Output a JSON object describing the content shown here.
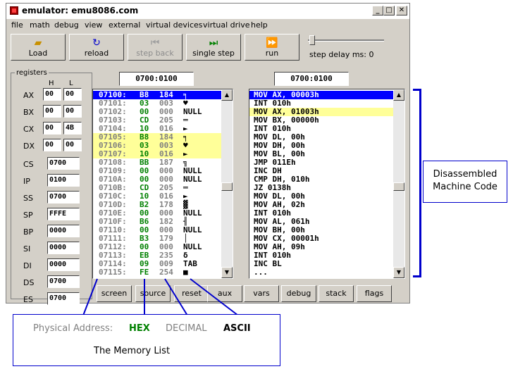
{
  "window": {
    "title": "emulator: emu8086.com",
    "min_glyph": "_",
    "max_glyph": "□",
    "close_glyph": "✕"
  },
  "menu": [
    "file",
    "math",
    "debug",
    "view",
    "external",
    "virtual devices",
    "virtual drive",
    "help"
  ],
  "toolbar": {
    "load": "Load",
    "reload": "reload",
    "step_back": "step back",
    "single_step": "single step",
    "run": "run",
    "step_delay_label": "step delay ms: 0"
  },
  "registers": {
    "title": "registers",
    "h_label": "H",
    "l_label": "L",
    "general": [
      {
        "name": "AX",
        "h": "00",
        "l": "00"
      },
      {
        "name": "BX",
        "h": "00",
        "l": "00"
      },
      {
        "name": "CX",
        "h": "00",
        "l": "4B"
      },
      {
        "name": "DX",
        "h": "00",
        "l": "00"
      }
    ],
    "segment": [
      {
        "name": "CS",
        "value": "0700"
      },
      {
        "name": "IP",
        "value": "0100"
      },
      {
        "name": "SS",
        "value": "0700"
      },
      {
        "name": "SP",
        "value": "FFFE"
      },
      {
        "name": "BP",
        "value": "0000"
      },
      {
        "name": "SI",
        "value": "0000"
      },
      {
        "name": "DI",
        "value": "0000"
      },
      {
        "name": "DS",
        "value": "0700"
      },
      {
        "name": "ES",
        "value": "0700"
      }
    ]
  },
  "memory_address": "0700:0100",
  "disasm_address": "0700:0100",
  "memory": [
    {
      "addr": "07100:",
      "hex": "B8",
      "dec": "184",
      "ascii": "╕",
      "state": "selected"
    },
    {
      "addr": "07101:",
      "hex": "03",
      "dec": "003",
      "ascii": "♥",
      "state": "normal"
    },
    {
      "addr": "07102:",
      "hex": "00",
      "dec": "000",
      "ascii": "NULL",
      "state": "normal"
    },
    {
      "addr": "07103:",
      "hex": "CD",
      "dec": "205",
      "ascii": "═",
      "state": "normal"
    },
    {
      "addr": "07104:",
      "hex": "10",
      "dec": "016",
      "ascii": "►",
      "state": "normal"
    },
    {
      "addr": "07105:",
      "hex": "B8",
      "dec": "184",
      "ascii": "╕",
      "state": "highlight"
    },
    {
      "addr": "07106:",
      "hex": "03",
      "dec": "003",
      "ascii": "♥",
      "state": "highlight"
    },
    {
      "addr": "07107:",
      "hex": "10",
      "dec": "016",
      "ascii": "►",
      "state": "highlight"
    },
    {
      "addr": "07108:",
      "hex": "BB",
      "dec": "187",
      "ascii": "╗",
      "state": "normal"
    },
    {
      "addr": "07109:",
      "hex": "00",
      "dec": "000",
      "ascii": "NULL",
      "state": "normal"
    },
    {
      "addr": "0710A:",
      "hex": "00",
      "dec": "000",
      "ascii": "NULL",
      "state": "normal"
    },
    {
      "addr": "0710B:",
      "hex": "CD",
      "dec": "205",
      "ascii": "═",
      "state": "normal"
    },
    {
      "addr": "0710C:",
      "hex": "10",
      "dec": "016",
      "ascii": "►",
      "state": "normal"
    },
    {
      "addr": "0710D:",
      "hex": "B2",
      "dec": "178",
      "ascii": "▓",
      "state": "normal"
    },
    {
      "addr": "0710E:",
      "hex": "00",
      "dec": "000",
      "ascii": "NULL",
      "state": "normal"
    },
    {
      "addr": "0710F:",
      "hex": "B6",
      "dec": "182",
      "ascii": "╢",
      "state": "normal"
    },
    {
      "addr": "07110:",
      "hex": "00",
      "dec": "000",
      "ascii": "NULL",
      "state": "normal"
    },
    {
      "addr": "07111:",
      "hex": "B3",
      "dec": "179",
      "ascii": "│",
      "state": "normal"
    },
    {
      "addr": "07112:",
      "hex": "00",
      "dec": "000",
      "ascii": "NULL",
      "state": "normal"
    },
    {
      "addr": "07113:",
      "hex": "EB",
      "dec": "235",
      "ascii": "δ",
      "state": "normal"
    },
    {
      "addr": "07114:",
      "hex": "09",
      "dec": "009",
      "ascii": "TAB",
      "state": "normal"
    },
    {
      "addr": "07115:",
      "hex": "FE",
      "dec": "254",
      "ascii": "■",
      "state": "normal"
    }
  ],
  "disassembly": [
    {
      "text": "MOV AX, 00003h",
      "state": "selected"
    },
    {
      "text": "INT 010h",
      "state": "normal"
    },
    {
      "text": "MOV AX, 01003h",
      "state": "highlight"
    },
    {
      "text": "MOV BX, 00000h",
      "state": "normal"
    },
    {
      "text": "INT 010h",
      "state": "normal"
    },
    {
      "text": "MOV DL, 00h",
      "state": "normal"
    },
    {
      "text": "MOV DH, 00h",
      "state": "normal"
    },
    {
      "text": "MOV BL, 00h",
      "state": "normal"
    },
    {
      "text": "JMP 011Eh",
      "state": "normal"
    },
    {
      "text": "INC DH",
      "state": "normal"
    },
    {
      "text": "CMP DH, 010h",
      "state": "normal"
    },
    {
      "text": "JZ 0138h",
      "state": "normal"
    },
    {
      "text": "MOV DL, 00h",
      "state": "normal"
    },
    {
      "text": "MOV AH, 02h",
      "state": "normal"
    },
    {
      "text": "INT 010h",
      "state": "normal"
    },
    {
      "text": "MOV AL, 061h",
      "state": "normal"
    },
    {
      "text": "MOV BH, 00h",
      "state": "normal"
    },
    {
      "text": "MOV CX, 00001h",
      "state": "normal"
    },
    {
      "text": "MOV AH, 09h",
      "state": "normal"
    },
    {
      "text": "INT 010h",
      "state": "normal"
    },
    {
      "text": "INC BL",
      "state": "normal"
    },
    {
      "text": "...",
      "state": "normal"
    }
  ],
  "bottom_buttons": [
    "screen",
    "source",
    "reset",
    "aux",
    "vars",
    "debug",
    "stack",
    "flags"
  ],
  "annotations": {
    "disasm_line1": "Disassembled",
    "disasm_line2": "Machine Code",
    "phys_label": "Physical Address:",
    "hex_label": "HEX",
    "dec_label": "DECIMAL",
    "ascii_label": "ASCII",
    "memlist_label": "The Memory List"
  },
  "colors": {
    "selected_bg": "#0000ff",
    "selected_fg": "#ffffff",
    "highlight_bg": "#ffff99",
    "addr_color": "#808080",
    "hex_color": "#008000",
    "dec_color": "#808080",
    "ascii_color": "#000000",
    "annotation_blue": "#0000cc"
  }
}
